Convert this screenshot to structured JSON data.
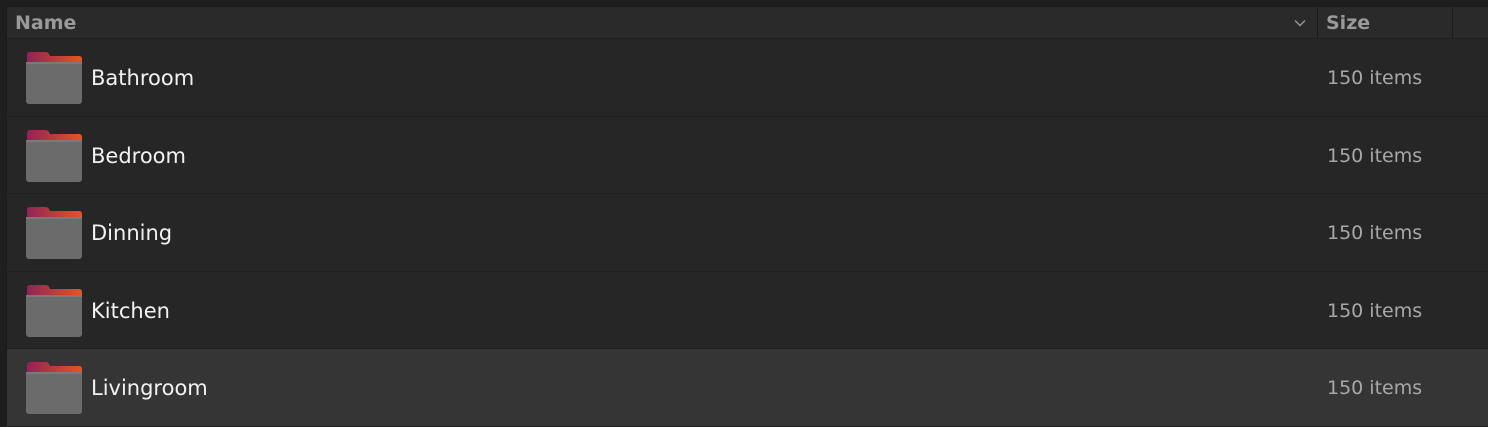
{
  "columns": {
    "name_label": "Name",
    "size_label": "Size",
    "sort_icon": "chevron-down-icon"
  },
  "rows": [
    {
      "name": "Bathroom",
      "size": "150 items",
      "icon": "folder-icon",
      "selected": false
    },
    {
      "name": "Bedroom",
      "size": "150 items",
      "icon": "folder-icon",
      "selected": false
    },
    {
      "name": "Dinning",
      "size": "150 items",
      "icon": "folder-icon",
      "selected": false
    },
    {
      "name": "Kitchen",
      "size": "150 items",
      "icon": "folder-icon",
      "selected": false
    },
    {
      "name": "Livingroom",
      "size": "150 items",
      "icon": "folder-icon",
      "selected": true
    }
  ],
  "colors": {
    "background": "#262626",
    "selected_row": "#353535",
    "folder_tab_start": "#8e2456",
    "folder_tab_end": "#e95420",
    "folder_body": "#6b6b6b"
  }
}
